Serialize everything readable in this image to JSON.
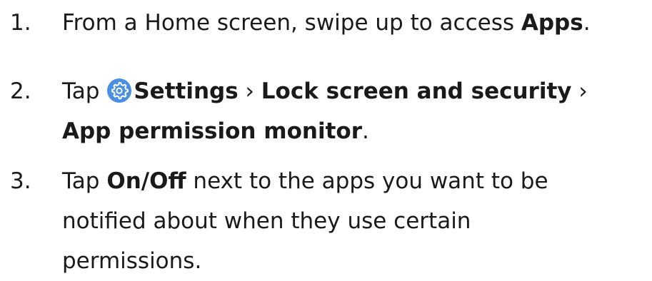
{
  "steps": [
    {
      "number": "1.",
      "parts": {
        "a": "From a Home screen, swipe up to access ",
        "apps": "Apps",
        "end": "."
      }
    },
    {
      "number": "2.",
      "parts": {
        "tap": "Tap ",
        "icon": "settings-gear-icon",
        "settings": "Settings",
        "sep1": " › ",
        "lock": "Lock screen and security",
        "sep2": " ›",
        "monitor": "App permission monitor",
        "end": "."
      }
    },
    {
      "number": "3.",
      "parts": {
        "tap": "Tap ",
        "onoff": "On/Off",
        "rest1": " next to the apps you want to be",
        "line2": "notified about when they use certain",
        "line3": "permissions."
      }
    }
  ],
  "colors": {
    "text": "#1a1a1a",
    "settings_icon_bg": "#4a90e2",
    "settings_icon_fg": "#ffffff"
  }
}
